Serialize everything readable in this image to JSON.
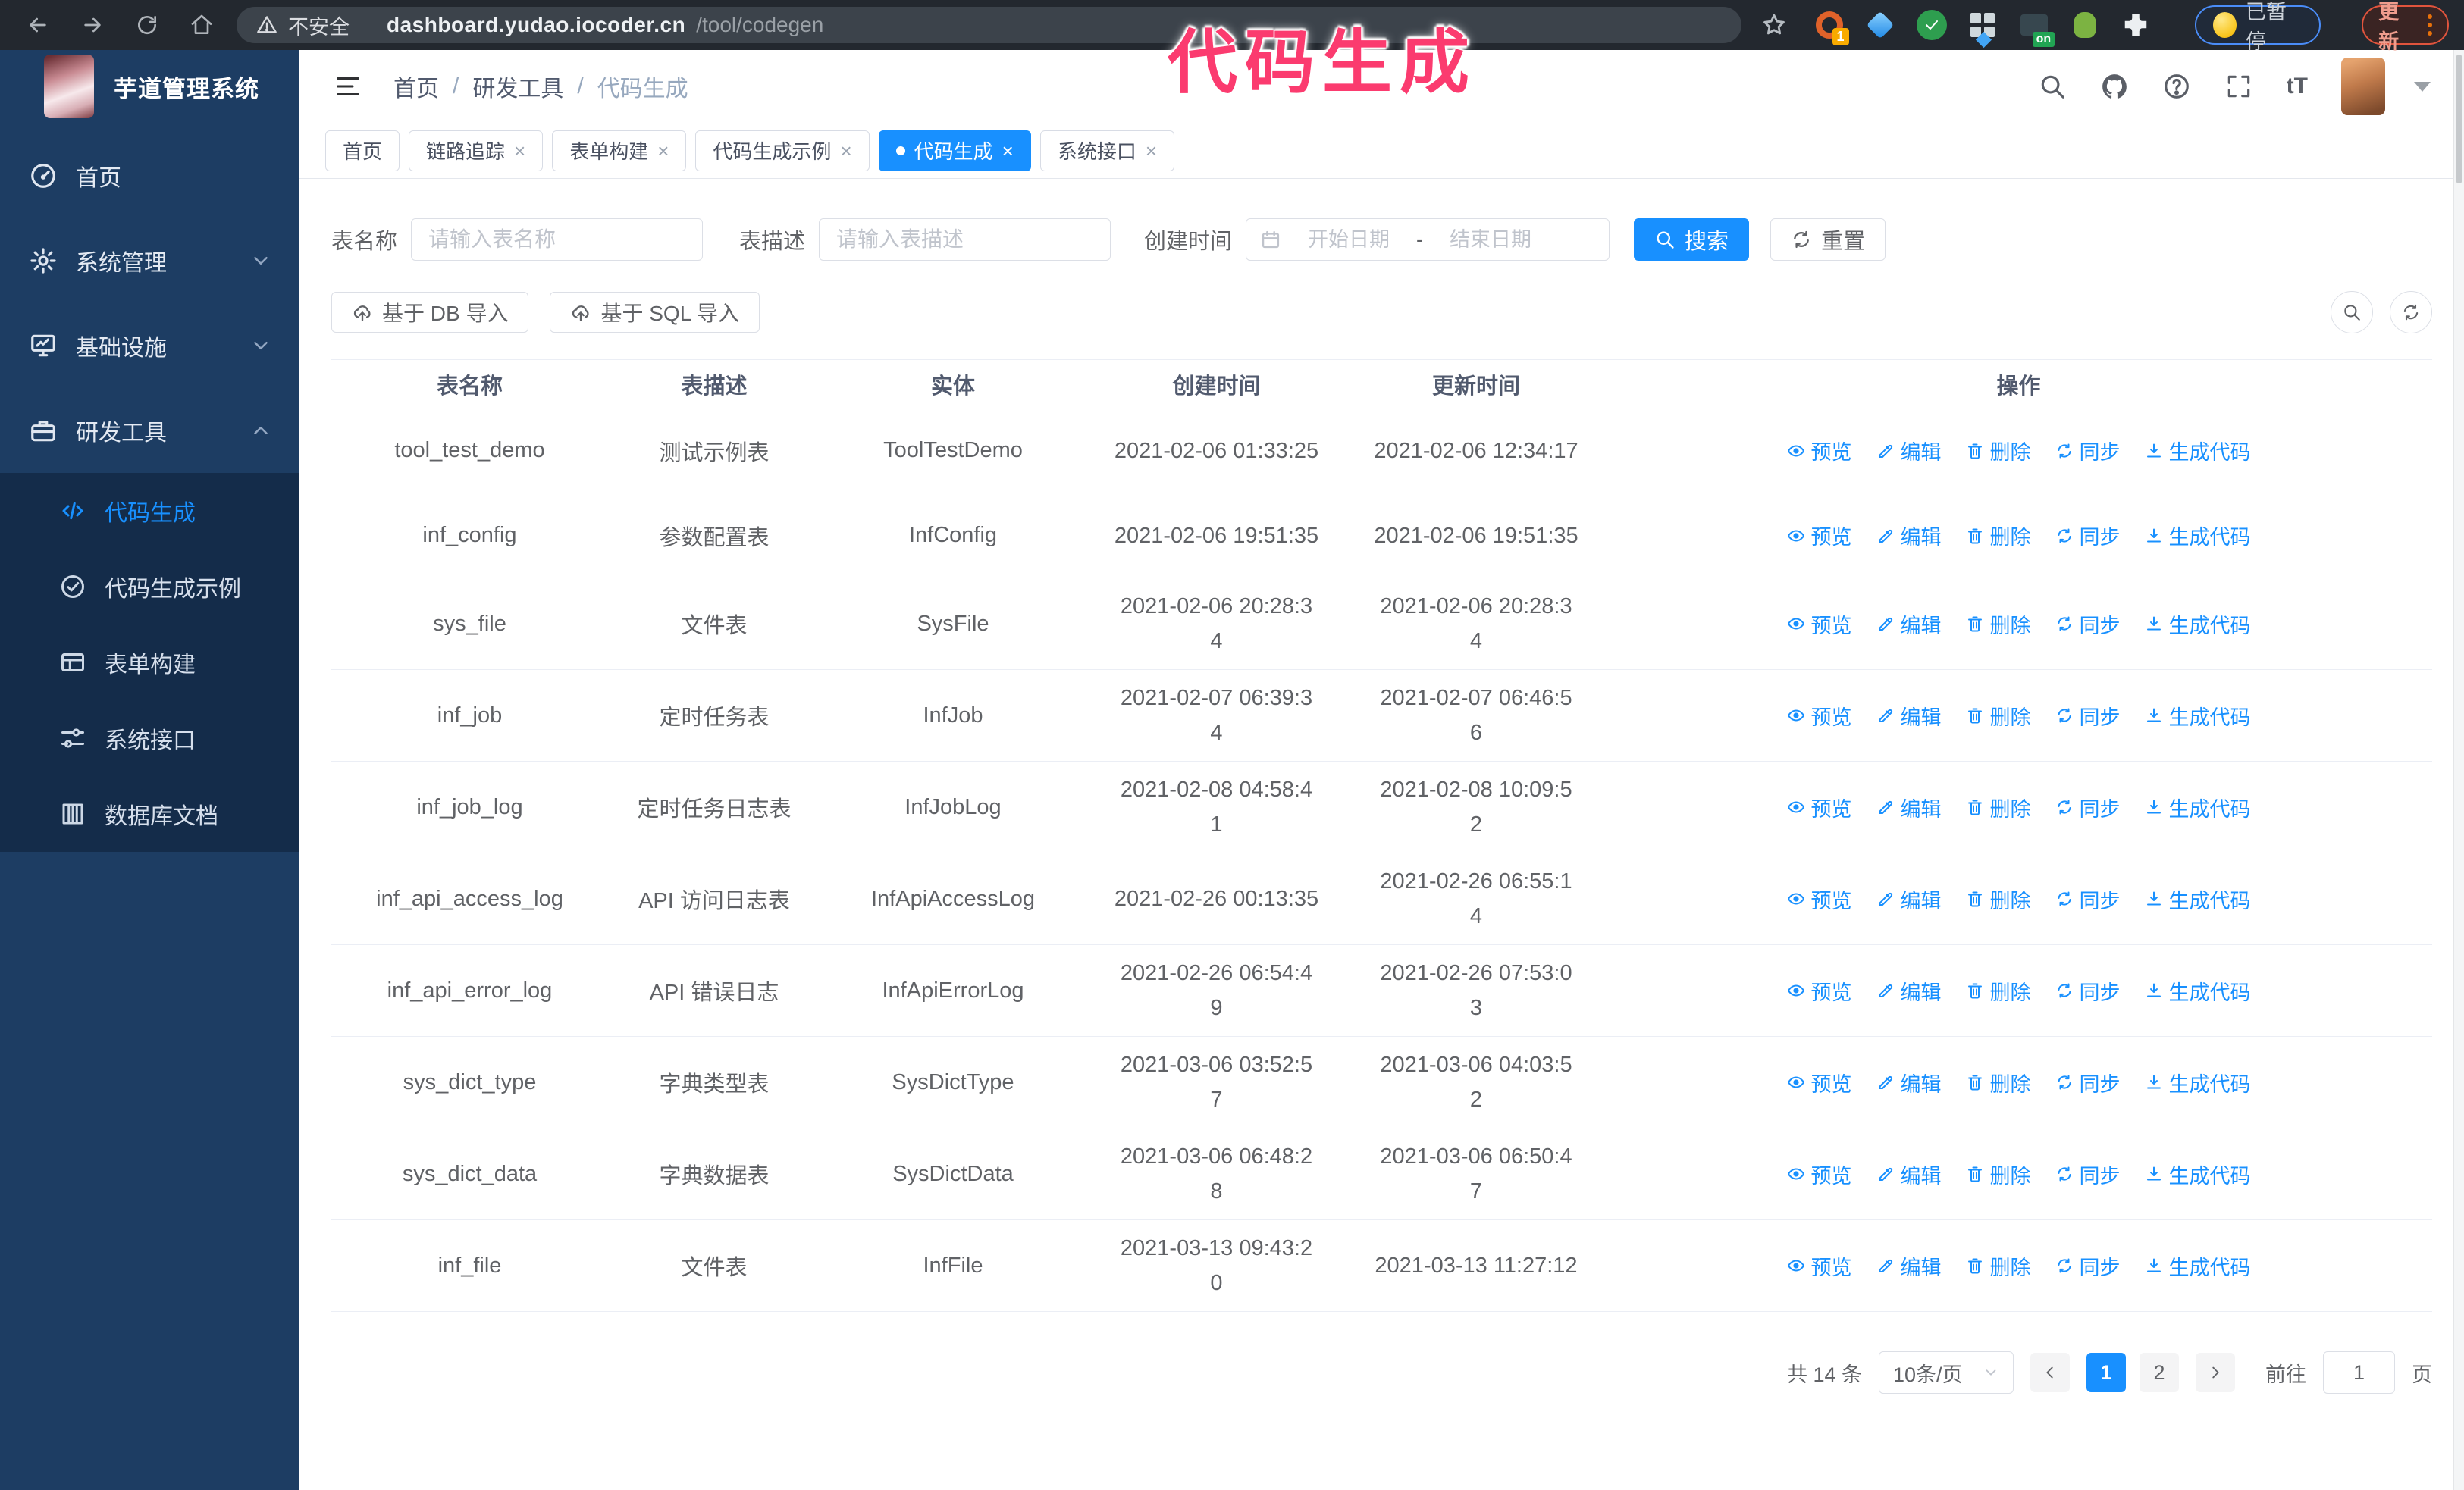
{
  "colors": {
    "accent": "#1890ff",
    "sidebar_bg": "#1d3d63",
    "submenu_bg": "#142c4a",
    "chrome_bar": "#23282f",
    "annotation": "#fb3b6f"
  },
  "chrome": {
    "security_label": "不安全",
    "host": "dashboard.yudao.iocoder.cn",
    "path": "/tool/codegen",
    "ext_badge_count": "1",
    "ext_badge_on": "on",
    "paused_label": "已暂停",
    "update_label": "更新"
  },
  "annotation_title": "代码生成",
  "sidebar": {
    "logo_title": "芋道管理系统",
    "menu": [
      {
        "label": "首页",
        "icon": "dashboard-icon",
        "arrow": "",
        "active": false
      },
      {
        "label": "系统管理",
        "icon": "gear-icon",
        "arrow": "down",
        "active": false
      },
      {
        "label": "基础设施",
        "icon": "infra-icon",
        "arrow": "down",
        "active": false
      },
      {
        "label": "研发工具",
        "icon": "tools-icon",
        "arrow": "up",
        "active": true
      }
    ],
    "submenu": [
      {
        "label": "代码生成",
        "icon": "code-icon",
        "active": true
      },
      {
        "label": "代码生成示例",
        "icon": "example-icon",
        "active": false
      },
      {
        "label": "表单构建",
        "icon": "form-icon",
        "active": false
      },
      {
        "label": "系统接口",
        "icon": "api-icon",
        "active": false
      },
      {
        "label": "数据库文档",
        "icon": "dbdoc-icon",
        "active": false
      }
    ]
  },
  "breadcrumb": [
    "首页",
    "研发工具",
    "代码生成"
  ],
  "tabs": [
    {
      "label": "首页",
      "closable": false,
      "active": false
    },
    {
      "label": "链路追踪",
      "closable": true,
      "active": false
    },
    {
      "label": "表单构建",
      "closable": true,
      "active": false
    },
    {
      "label": "代码生成示例",
      "closable": true,
      "active": false
    },
    {
      "label": "代码生成",
      "closable": true,
      "active": true
    },
    {
      "label": "系统接口",
      "closable": true,
      "active": false
    }
  ],
  "filters": {
    "table_name_label": "表名称",
    "table_name_placeholder": "请输入表名称",
    "table_desc_label": "表描述",
    "table_desc_placeholder": "请输入表描述",
    "created_label": "创建时间",
    "date_start_placeholder": "开始日期",
    "date_separator": "-",
    "date_end_placeholder": "结束日期",
    "search_label": "搜索",
    "reset_label": "重置"
  },
  "toolbar": {
    "import_db": "基于 DB 导入",
    "import_sql": "基于 SQL 导入"
  },
  "table": {
    "columns": [
      "表名称",
      "表描述",
      "实体",
      "创建时间",
      "更新时间",
      "操作"
    ],
    "actions": [
      {
        "key": "preview",
        "label": "预览",
        "icon": "eye-icon"
      },
      {
        "key": "edit",
        "label": "编辑",
        "icon": "edit-icon"
      },
      {
        "key": "delete",
        "label": "删除",
        "icon": "delete-icon"
      },
      {
        "key": "sync",
        "label": "同步",
        "icon": "sync-icon"
      },
      {
        "key": "generate-code",
        "label": "生成代码",
        "icon": "download-icon"
      }
    ],
    "rows": [
      {
        "name": "tool_test_demo",
        "desc": "测试示例表",
        "entity": "ToolTestDemo",
        "created": "2021-02-06 01:33:25",
        "updated": "2021-02-06 12:34:17"
      },
      {
        "name": "inf_config",
        "desc": "参数配置表",
        "entity": "InfConfig",
        "created": "2021-02-06 19:51:35",
        "updated": "2021-02-06 19:51:35"
      },
      {
        "name": "sys_file",
        "desc": "文件表",
        "entity": "SysFile",
        "created": "2021-02-06 20:28:3\n4",
        "updated": "2021-02-06 20:28:3\n4"
      },
      {
        "name": "inf_job",
        "desc": "定时任务表",
        "entity": "InfJob",
        "created": "2021-02-07 06:39:3\n4",
        "updated": "2021-02-07 06:46:5\n6"
      },
      {
        "name": "inf_job_log",
        "desc": "定时任务日志表",
        "entity": "InfJobLog",
        "created": "2021-02-08 04:58:4\n1",
        "updated": "2021-02-08 10:09:5\n2"
      },
      {
        "name": "inf_api_access_log",
        "desc": "API 访问日志表",
        "entity": "InfApiAccessLog",
        "created": "2021-02-26 00:13:35",
        "updated": "2021-02-26 06:55:1\n4"
      },
      {
        "name": "inf_api_error_log",
        "desc": "API 错误日志",
        "entity": "InfApiErrorLog",
        "created": "2021-02-26 06:54:4\n9",
        "updated": "2021-02-26 07:53:0\n3"
      },
      {
        "name": "sys_dict_type",
        "desc": "字典类型表",
        "entity": "SysDictType",
        "created": "2021-03-06 03:52:5\n7",
        "updated": "2021-03-06 04:03:5\n2"
      },
      {
        "name": "sys_dict_data",
        "desc": "字典数据表",
        "entity": "SysDictData",
        "created": "2021-03-06 06:48:2\n8",
        "updated": "2021-03-06 06:50:4\n7"
      },
      {
        "name": "inf_file",
        "desc": "文件表",
        "entity": "InfFile",
        "created": "2021-03-13 09:43:2\n0",
        "updated": "2021-03-13 11:27:12"
      }
    ]
  },
  "pagination": {
    "total": "共 14 条",
    "page_size": "10条/页",
    "pages": [
      "1",
      "2"
    ],
    "active_page": "1",
    "goto_label": "前往",
    "goto_value": "1",
    "goto_suffix": "页"
  }
}
